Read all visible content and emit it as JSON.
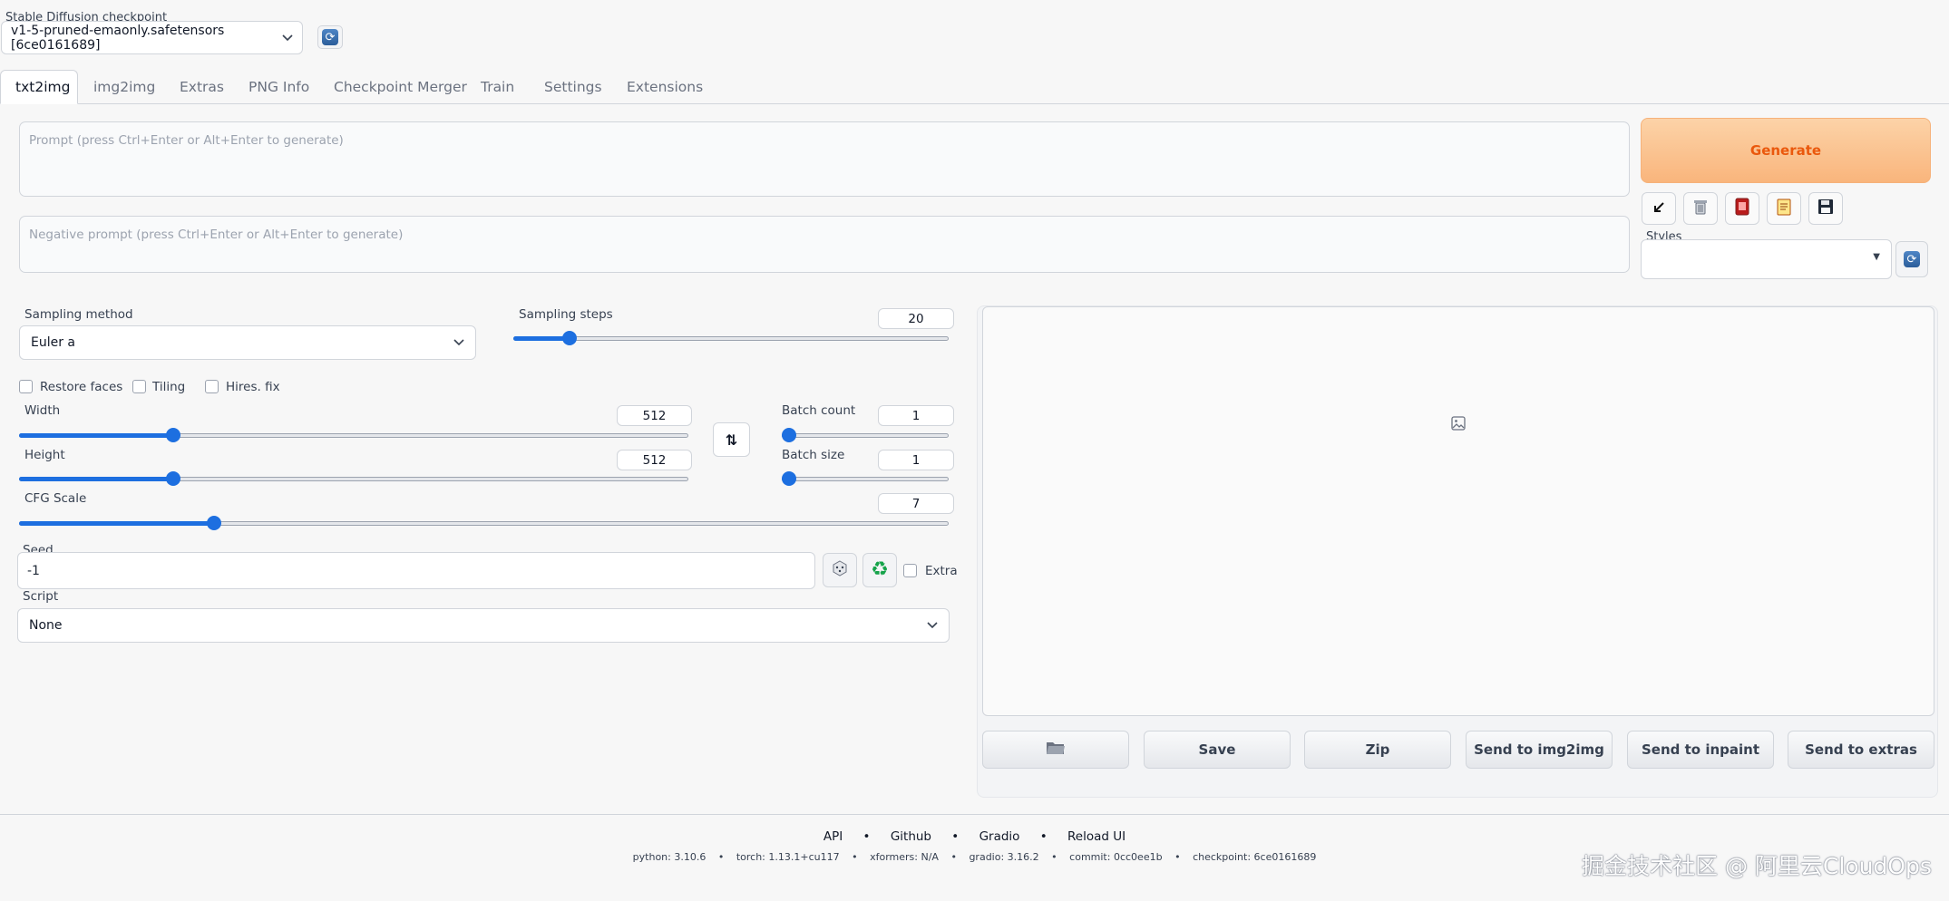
{
  "checkpoint": {
    "label": "Stable Diffusion checkpoint",
    "value": "v1-5-pruned-emaonly.safetensors [6ce0161689]"
  },
  "tabs": [
    "txt2img",
    "img2img",
    "Extras",
    "PNG Info",
    "Checkpoint Merger",
    "Train",
    "Settings",
    "Extensions"
  ],
  "prompt": {
    "placeholder": "Prompt (press Ctrl+Enter or Alt+Enter to generate)"
  },
  "negative_prompt": {
    "placeholder": "Negative prompt (press Ctrl+Enter or Alt+Enter to generate)"
  },
  "generate": {
    "label": "Generate"
  },
  "styles": {
    "label": "Styles"
  },
  "sampling": {
    "method_label": "Sampling method",
    "method_value": "Euler a",
    "steps_label": "Sampling steps",
    "steps_value": "20",
    "steps_fraction": 0.13
  },
  "options": {
    "restore_faces": "Restore faces",
    "tiling": "Tiling",
    "hires_fix": "Hires. fix"
  },
  "width": {
    "label": "Width",
    "value": "512",
    "fraction": 0.23
  },
  "height": {
    "label": "Height",
    "value": "512",
    "fraction": 0.23
  },
  "batch_count": {
    "label": "Batch count",
    "value": "1",
    "fraction": 0.0
  },
  "batch_size": {
    "label": "Batch size",
    "value": "1",
    "fraction": 0.0
  },
  "cfg_scale": {
    "label": "CFG Scale",
    "value": "7",
    "fraction": 0.21
  },
  "seed": {
    "label": "Seed",
    "value": "-1",
    "extra_label": "Extra"
  },
  "script": {
    "label": "Script",
    "value": "None"
  },
  "output_buttons": {
    "folder_icon": "folder-icon",
    "save": "Save",
    "zip": "Zip",
    "send_img2img": "Send to img2img",
    "send_inpaint": "Send to inpaint",
    "send_extras": "Send to extras"
  },
  "footer": {
    "links": [
      "API",
      "Github",
      "Gradio",
      "Reload UI"
    ],
    "separator": "•",
    "versions": [
      "python: 3.10.6",
      "torch: 1.13.1+cu117",
      "xformers: N/A",
      "gradio: 3.16.2",
      "commit: 0cc0ee1b",
      "checkpoint: 6ce0161689"
    ]
  },
  "watermark": "掘金技术社区 @ 阿里云CloudOps",
  "colors": {
    "accent": "#1d6fe0",
    "generate_bg": "#f9b57c",
    "generate_text": "#ea580c"
  }
}
